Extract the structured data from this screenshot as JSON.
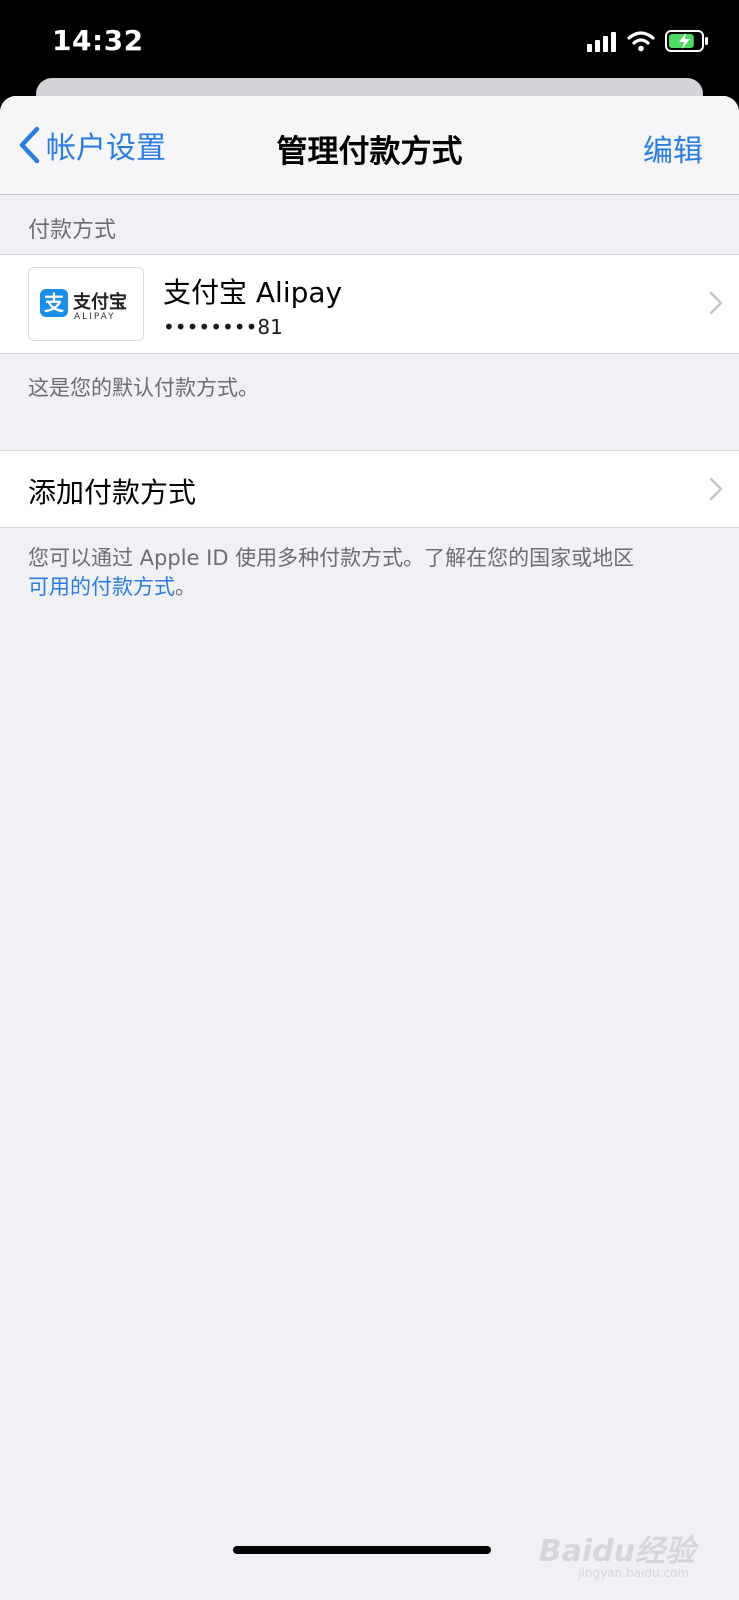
{
  "status_bar": {
    "time": "14:32",
    "battery_level": 0.8,
    "battery_color": "#4cd964",
    "icons": [
      "cellular-signal-icon",
      "wifi-icon",
      "battery-charging-icon"
    ]
  },
  "nav": {
    "back_label": "帐户设置",
    "title": "管理付款方式",
    "edit_label": "编辑"
  },
  "section_header": "付款方式",
  "payment_method": {
    "logo_text": "支付宝",
    "logo_subtext": "ALIPAY",
    "logo_mark": "支",
    "name": "支付宝 Alipay",
    "masked_number": "••••••••81",
    "brand_color": "#1b8fe6"
  },
  "default_note": "这是您的默认付款方式。",
  "add_payment": {
    "label": "添加付款方式"
  },
  "footer": {
    "text": "您可以通过 Apple ID 使用多种付款方式。了解在您的国家或地区",
    "link_text": "可用的付款方式",
    "suffix": "。"
  },
  "watermark": {
    "text": "Baidu经验",
    "subtext": "jingyan.baidu.com"
  },
  "colors": {
    "accent": "#2b7de0",
    "background": "#f0f0f5",
    "secondary_text": "#6d6d72"
  }
}
